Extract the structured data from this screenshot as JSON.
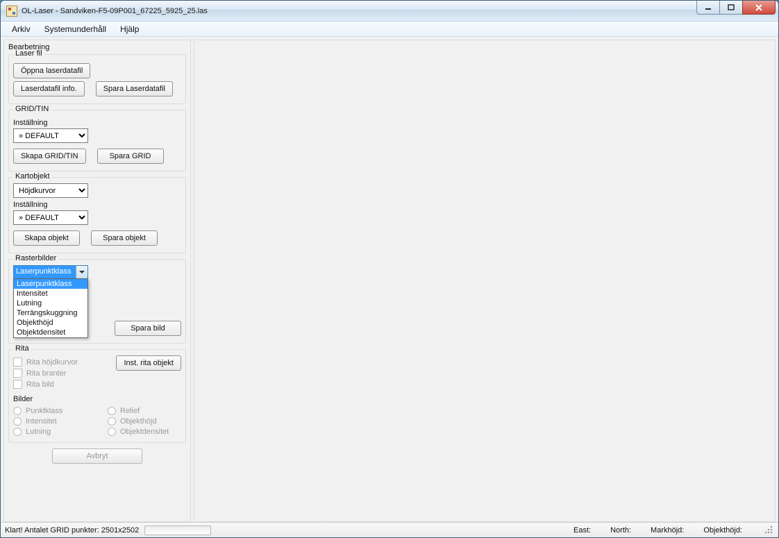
{
  "window": {
    "title": "OL-Laser - Sandviken-F5-09P001_67225_5925_25.las"
  },
  "menu": {
    "arkiv": "Arkiv",
    "systemunderhall": "Systemunderhåll",
    "hjalp": "Hjälp"
  },
  "panel": {
    "bearbetning_title": "Bearbetning",
    "laserfil": {
      "title": "Laser fil",
      "open": "Öppna laserdatafil",
      "info": "Laserdatafil info.",
      "save": "Spara Laserdatafil"
    },
    "gridtin": {
      "title": "GRID/TIN",
      "installning_label": "Inställning",
      "installning_value": "» DEFAULT",
      "skapa": "Skapa GRID/TIN",
      "spara": "Spara GRID"
    },
    "kartobjekt": {
      "title": "Kartobjekt",
      "type_value": "Höjdkurvor",
      "installning_label": "Inställning",
      "installning_value": "» DEFAULT",
      "skapa": "Skapa objekt",
      "spara": "Spara objekt"
    },
    "rasterbilder": {
      "title": "Rasterbilder",
      "selected": "Laserpunktklass",
      "options": [
        "Laserpunktklass",
        "Intensitet",
        "Lutning",
        "Terrängskuggning",
        "Objekthöjd",
        "Objektdensitet"
      ],
      "spara": "Spara bild"
    },
    "rita": {
      "title": "Rita",
      "chk_hojdkurvor": "Rita höjdkurvor",
      "chk_branter": "Rita branter",
      "chk_bild": "Rita bild",
      "inst_btn": "Inst. rita objekt"
    },
    "bilder": {
      "title": "Bilder",
      "r_punktklass": "Punktklass",
      "r_intensitet": "Intensitet",
      "r_lutning": "Lutning",
      "r_relief": "Relief",
      "r_objekthojd": "Objekthöjd",
      "r_objektdensitet": "Objektdensitet"
    },
    "avbryt": "Avbryt"
  },
  "status": {
    "message": "Klart! Antalet GRID punkter: 2501x2502",
    "east_label": "East:",
    "north_label": "North:",
    "markhojd_label": "Markhöjd:",
    "objekthojd_label": "Objekthöjd:"
  }
}
